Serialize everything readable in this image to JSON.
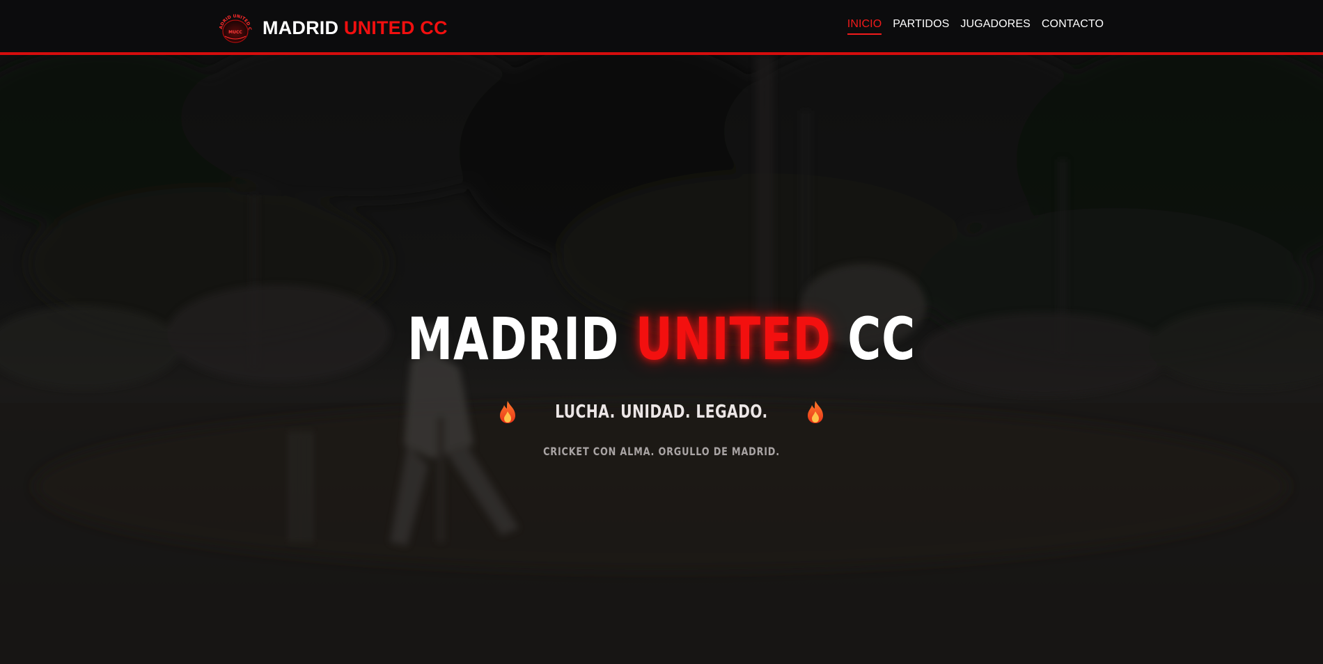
{
  "header": {
    "logo_text": "MADRID UNITED CC · MUCC",
    "brand_part1": "MADRID",
    "brand_part2": "UNITED CC",
    "nav": [
      {
        "label": "INICIO",
        "active": true
      },
      {
        "label": "PARTIDOS",
        "active": false
      },
      {
        "label": "JUGADORES",
        "active": false
      },
      {
        "label": "CONTACTO",
        "active": false
      }
    ]
  },
  "hero": {
    "title_part1": "MADRID",
    "title_part2": "UNITED",
    "title_part3": "CC",
    "tagline": "LUCHA. UNIDAD. LEGADO.",
    "subtitle": "CRICKET CON ALMA. ORGULLO DE MADRID.",
    "tagline_icons": [
      "fire-icon",
      "fire-icon"
    ]
  },
  "colors": {
    "accent_red": "#f10f0f",
    "header_bg": "#0c0c0d",
    "text_white": "#ffffff",
    "subtitle_gray": "#a9a4a4"
  }
}
